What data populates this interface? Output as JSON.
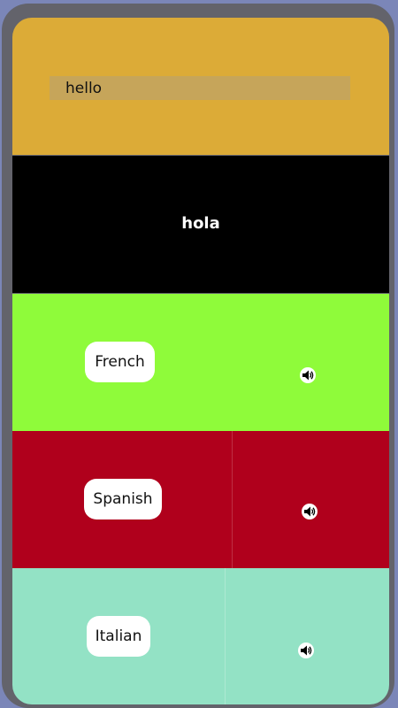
{
  "input": {
    "value": "hello"
  },
  "output": {
    "text": "hola"
  },
  "languages": [
    {
      "label": "French",
      "color": "#8ffb3a",
      "icon": "speaker-icon"
    },
    {
      "label": "Spanish",
      "color": "#b0001c",
      "icon": "speaker-icon"
    },
    {
      "label": "Italian",
      "color": "#93e2c5",
      "icon": "speaker-icon"
    }
  ],
  "colors": {
    "input_section": "#dcab37",
    "output_section": "#000000",
    "device_frame": "#63636b",
    "background": "#7b86b8"
  }
}
